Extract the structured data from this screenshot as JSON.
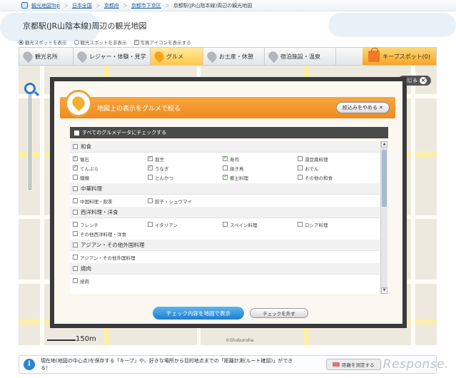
{
  "breadcrumb": [
    "観光地図Top",
    "日本全国",
    "京都府",
    "京都市下京区",
    "京都駅(JR山陰本線)周辺の観光地図"
  ],
  "page_title": "京都駅(JR山陰本線)周辺の観光地図",
  "options": {
    "radio1": "観光スポットを表示",
    "radio2": "観光スポットを非表示",
    "checkbox": "写真アイコンを表示する"
  },
  "tabs": [
    {
      "label": "観光名所",
      "active": false
    },
    {
      "label": "レジャー・体験・見学",
      "active": false
    },
    {
      "label": "グルメ",
      "active": true
    },
    {
      "label": "お土産・休憩",
      "active": false
    },
    {
      "label": "宿泊施設・温泉",
      "active": false
    }
  ],
  "keep_spot": "キープスポット(0)",
  "map": {
    "close_label": "閉じる",
    "scale": "150m",
    "copyright": "©Shobunsha"
  },
  "modal": {
    "title": "地図上の表示をグルメで絞る",
    "reset_button": "絞込みをやめる ✕",
    "check_all": "すべてのグルメデータにチェックする",
    "categories": [
      {
        "label": "和食",
        "checked": false,
        "items": [
          {
            "label": "懐石",
            "checked": true
          },
          {
            "label": "割烹",
            "checked": true
          },
          {
            "label": "寿司",
            "checked": true
          },
          {
            "label": "湯豆腐料理",
            "checked": false
          },
          {
            "label": "てんぷら",
            "checked": true
          },
          {
            "label": "うなぎ",
            "checked": true
          },
          {
            "label": "焼き鳥",
            "checked": false
          },
          {
            "label": "おでん",
            "checked": false
          },
          {
            "label": "麺類",
            "checked": false
          },
          {
            "label": "とんかつ",
            "checked": false
          },
          {
            "label": "郷土料理",
            "checked": true
          },
          {
            "label": "その他の和食",
            "checked": false
          }
        ]
      },
      {
        "label": "中華料理",
        "checked": false,
        "items": [
          {
            "label": "中国料理・飲茶",
            "checked": false
          },
          {
            "label": "餃子・シュウマイ",
            "checked": false
          }
        ]
      },
      {
        "label": "西洋料理・洋食",
        "checked": false,
        "items": [
          {
            "label": "フレンチ",
            "checked": false
          },
          {
            "label": "イタリアン",
            "checked": false
          },
          {
            "label": "スペイン料理",
            "checked": false
          },
          {
            "label": "ロシア料理",
            "checked": false
          },
          {
            "label": "その他西洋料理・洋食",
            "checked": false
          }
        ]
      },
      {
        "label": "アジアン・その他外国料理",
        "checked": false,
        "items": [
          {
            "label": "アジアン・その他外国料理",
            "checked": false
          }
        ]
      },
      {
        "label": "焼肉",
        "checked": false,
        "items": [
          {
            "label": "焼肉",
            "checked": false
          }
        ]
      }
    ],
    "apply_button": "チェック内容を地図で表示",
    "clear_button": "チェックを外す"
  },
  "footer": {
    "info": "i",
    "text": "現在地(地図の中心点)を保存する「キープ」や、好きな場所から目的地点までの「距離計測(ルート確認)」ができる！",
    "distance_button": "距離を測定する"
  },
  "watermark": "Response."
}
